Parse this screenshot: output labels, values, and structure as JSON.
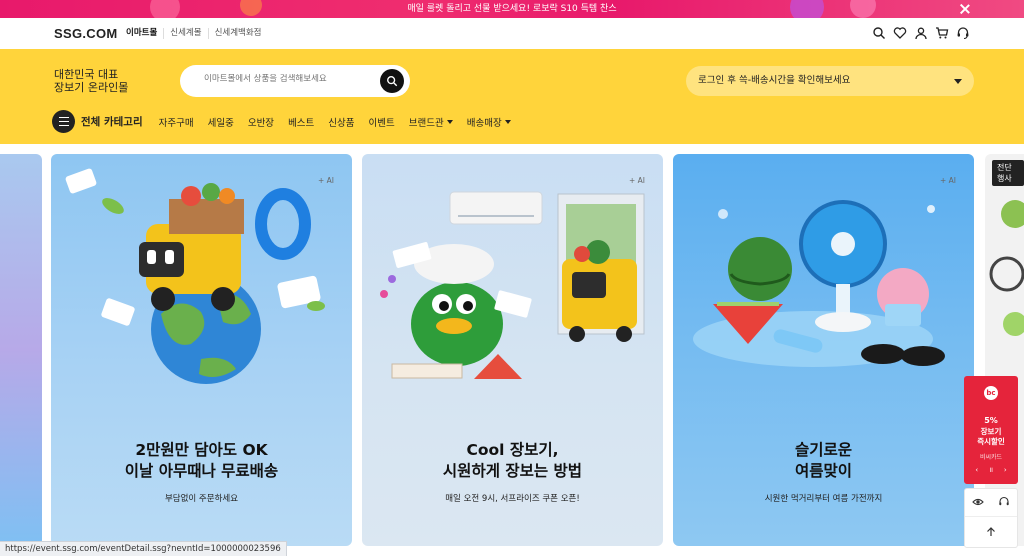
{
  "promo": {
    "text": "매일 룰렛 돌리고 선물 받으세요! 로보락 S10 득템 찬스"
  },
  "topnav": {
    "logo": "SSG.COM",
    "malls": [
      "이마트몰",
      "신세계몰",
      "신세계백화점"
    ]
  },
  "header": {
    "tagline_line1": "대한민국 대표",
    "tagline_line2": "장보기 온라인몰",
    "search_placeholder": "이마트몰에서 상품을 검색해보세요",
    "delivery_text": "로그인 후 쓱-배송시간을 확인해보세요"
  },
  "categories": {
    "all_label": "전체 카테고리",
    "items": [
      "자주구매",
      "세일중",
      "오반장",
      "베스트",
      "신상품",
      "이벤트",
      "브랜드관",
      "배송매장"
    ]
  },
  "cards": [
    {
      "ai": "+ AI",
      "title": "2만원만 담아도 OK\n이날 아무때나 무료배송",
      "sub": "부담없이 주문하세요"
    },
    {
      "ai": "+ AI",
      "title": "Cool 장보기,\n시원하게 장보는 방법",
      "sub": "매일 오전 9시, 서프라이즈 쿠폰 오픈!"
    },
    {
      "ai": "+ AI",
      "title": "슬기로운\n여름맞이",
      "sub": "시원한 먹거리부터 여름 가전까지"
    }
  ],
  "edge_label": "전단행사",
  "float_promo": {
    "pct": "5%",
    "line1": "장보기",
    "line2": "즉시할인",
    "card": "비씨카드",
    "prev": "‹",
    "pause": "॥",
    "next": "›"
  },
  "status_url": "https://event.ssg.com/eventDetail.ssg?nevntId=1000000023596",
  "colors": {
    "promo_bg": "#e8196b",
    "header_yellow": "#ffd43b",
    "float_red": "#e5243b"
  },
  "icons": [
    "search-icon",
    "heart-icon",
    "user-icon",
    "cart-icon",
    "headset-icon",
    "eye-icon",
    "arrow-up-icon"
  ]
}
